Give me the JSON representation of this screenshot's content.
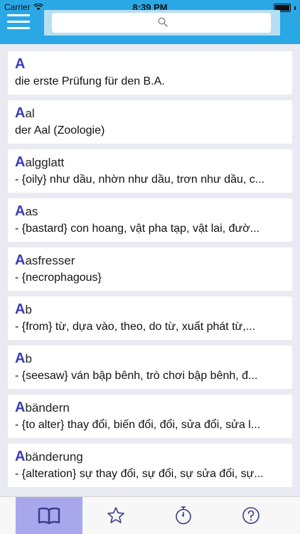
{
  "status": {
    "carrier": "Carrier",
    "time": "8:39 PM"
  },
  "search": {
    "placeholder": "",
    "value": ""
  },
  "entries": [
    {
      "initial": "A",
      "rest": "",
      "meaning": "die erste Prüfung für den B.A."
    },
    {
      "initial": "A",
      "rest": "al",
      "meaning": "der Aal (Zoologie)"
    },
    {
      "initial": "A",
      "rest": "algglatt",
      "meaning": "- {oily} như dầu, nhờn như dầu, trơn như dầu, c..."
    },
    {
      "initial": "A",
      "rest": "as",
      "meaning": "- {bastard} con hoang, vật pha tạp, vật lai, đườ..."
    },
    {
      "initial": "A",
      "rest": "asfresser",
      "meaning": "- {necrophagous}"
    },
    {
      "initial": "A",
      "rest": "b",
      "meaning": "- {from} từ, dựa vào, theo, do từ, xuất phát từ,..."
    },
    {
      "initial": "A",
      "rest": "b",
      "meaning": "- {seesaw} ván bập bênh, trò chơi bập bênh, đ..."
    },
    {
      "initial": "A",
      "rest": "bändern",
      "meaning": "- {to alter} thay đổi, biến đổi, đổi, sửa đổi, sửa l..."
    },
    {
      "initial": "A",
      "rest": "bänderung",
      "meaning": "- {alteration} sự thay đổi, sự đổi, sự sửa đổi, sự..."
    }
  ],
  "tabs": [
    {
      "icon": "book-icon",
      "active": true
    },
    {
      "icon": "star-icon",
      "active": false
    },
    {
      "icon": "stopwatch-icon",
      "active": false
    },
    {
      "icon": "help-icon",
      "active": false
    }
  ],
  "colors": {
    "header": "#2aa8e6",
    "initial": "#3a3abf",
    "active_tab": "#a9a7ec"
  }
}
